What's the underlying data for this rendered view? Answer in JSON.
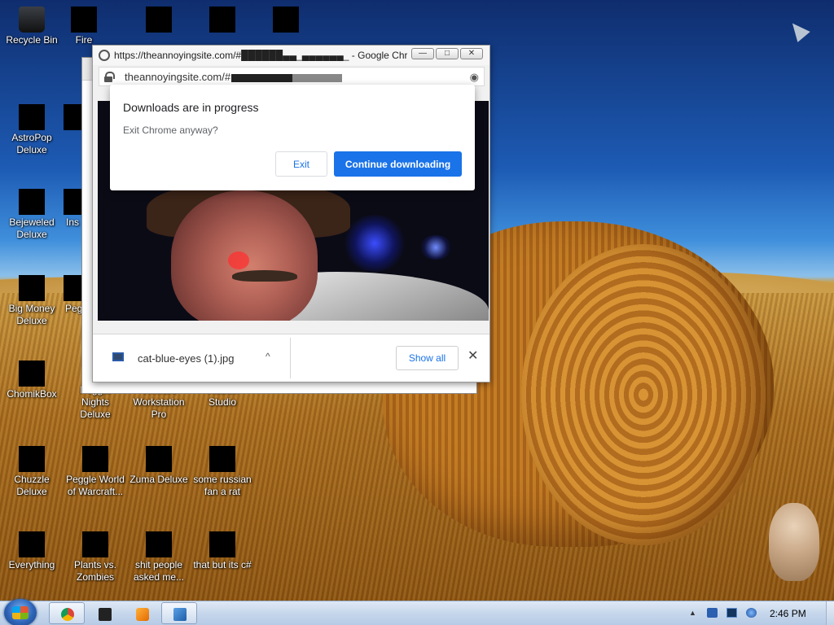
{
  "desktop": {
    "icons": [
      {
        "label": "Recycle Bin"
      },
      {
        "label": "Fire"
      },
      {
        "label": "AstroPop Deluxe"
      },
      {
        "label": "Bejeweled Deluxe"
      },
      {
        "label": "Ins"
      },
      {
        "label": "Big Money Deluxe"
      },
      {
        "label": "Peg"
      },
      {
        "label": "ChomikBox"
      },
      {
        "label": "Peggle Nights Deluxe"
      },
      {
        "label": "VMware Workstation Pro"
      },
      {
        "label": "Roblox Studio"
      },
      {
        "label": "Chuzzle Deluxe"
      },
      {
        "label": "Peggle World of Warcraft..."
      },
      {
        "label": "Zuma Deluxe"
      },
      {
        "label": "some russian fan a rat"
      },
      {
        "label": "Everything"
      },
      {
        "label": "Plants vs. Zombies"
      },
      {
        "label": "shit people asked me..."
      },
      {
        "label": "that but its c#"
      }
    ]
  },
  "chrome": {
    "title": "https://theannoyingsite.com/#██████▄▄_▄▄▄▄▄▄_ - Google Chr...",
    "url": "theannoyingsite.com/#",
    "controls": {
      "minimize": "—",
      "maximize": "□",
      "close": "✕"
    }
  },
  "dialog": {
    "title": "Downloads are in progress",
    "message": "Exit Chrome anyway?",
    "exit_label": "Exit",
    "continue_label": "Continue downloading"
  },
  "download_shelf": {
    "filename": "cat-blue-eyes (1).jpg",
    "chevron": "^",
    "show_all_label": "Show all",
    "close_glyph": "✕"
  },
  "taskbar": {
    "clock": "2:46 PM",
    "tray_arrow": "▲"
  },
  "colors": {
    "chrome_blue": "#1a73e8",
    "taskbar": "#c6d7ec"
  }
}
